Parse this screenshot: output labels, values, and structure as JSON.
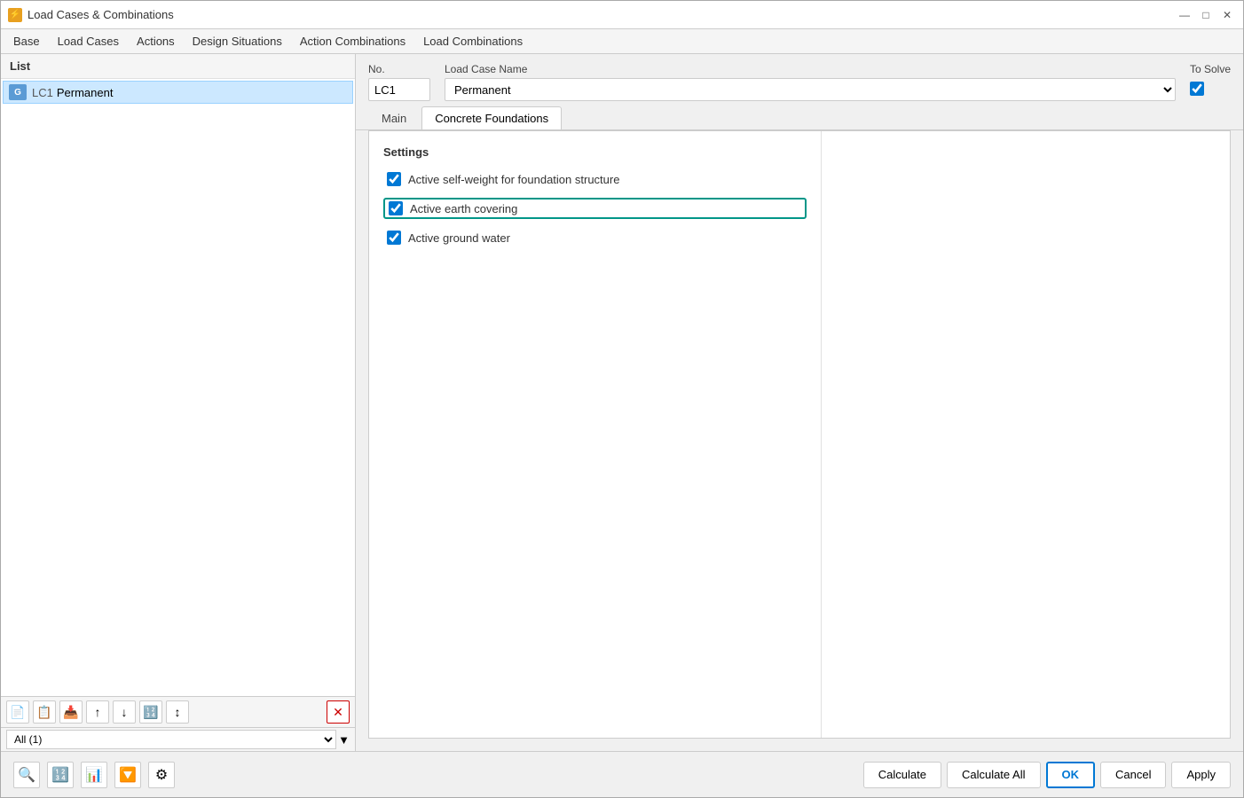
{
  "window": {
    "title": "Load Cases & Combinations",
    "icon": "⚡"
  },
  "menu": {
    "items": [
      "Base",
      "Load Cases",
      "Actions",
      "Design Situations",
      "Action Combinations",
      "Load Combinations"
    ]
  },
  "left_panel": {
    "header": "List",
    "items": [
      {
        "badge": "G",
        "number": "LC1",
        "label": "Permanent"
      }
    ],
    "filter": {
      "value": "All (1)",
      "options": [
        "All (1)"
      ]
    }
  },
  "right_panel": {
    "no_label": "No.",
    "no_value": "LC1",
    "load_case_name_label": "Load Case Name",
    "load_case_name_value": "Permanent",
    "to_solve_label": "To Solve",
    "tabs": [
      "Main",
      "Concrete Foundations"
    ],
    "active_tab": "Concrete Foundations",
    "settings": {
      "heading": "Settings",
      "checkboxes": [
        {
          "id": "cb1",
          "label": "Active self-weight for foundation structure",
          "checked": true,
          "highlighted": false
        },
        {
          "id": "cb2",
          "label": "Active earth covering",
          "checked": true,
          "highlighted": true
        },
        {
          "id": "cb3",
          "label": "Active ground water",
          "checked": true,
          "highlighted": false
        }
      ]
    }
  },
  "bottom_bar": {
    "buttons": {
      "calculate": "Calculate",
      "calculate_all": "Calculate All",
      "ok": "OK",
      "cancel": "Cancel",
      "apply": "Apply"
    }
  }
}
